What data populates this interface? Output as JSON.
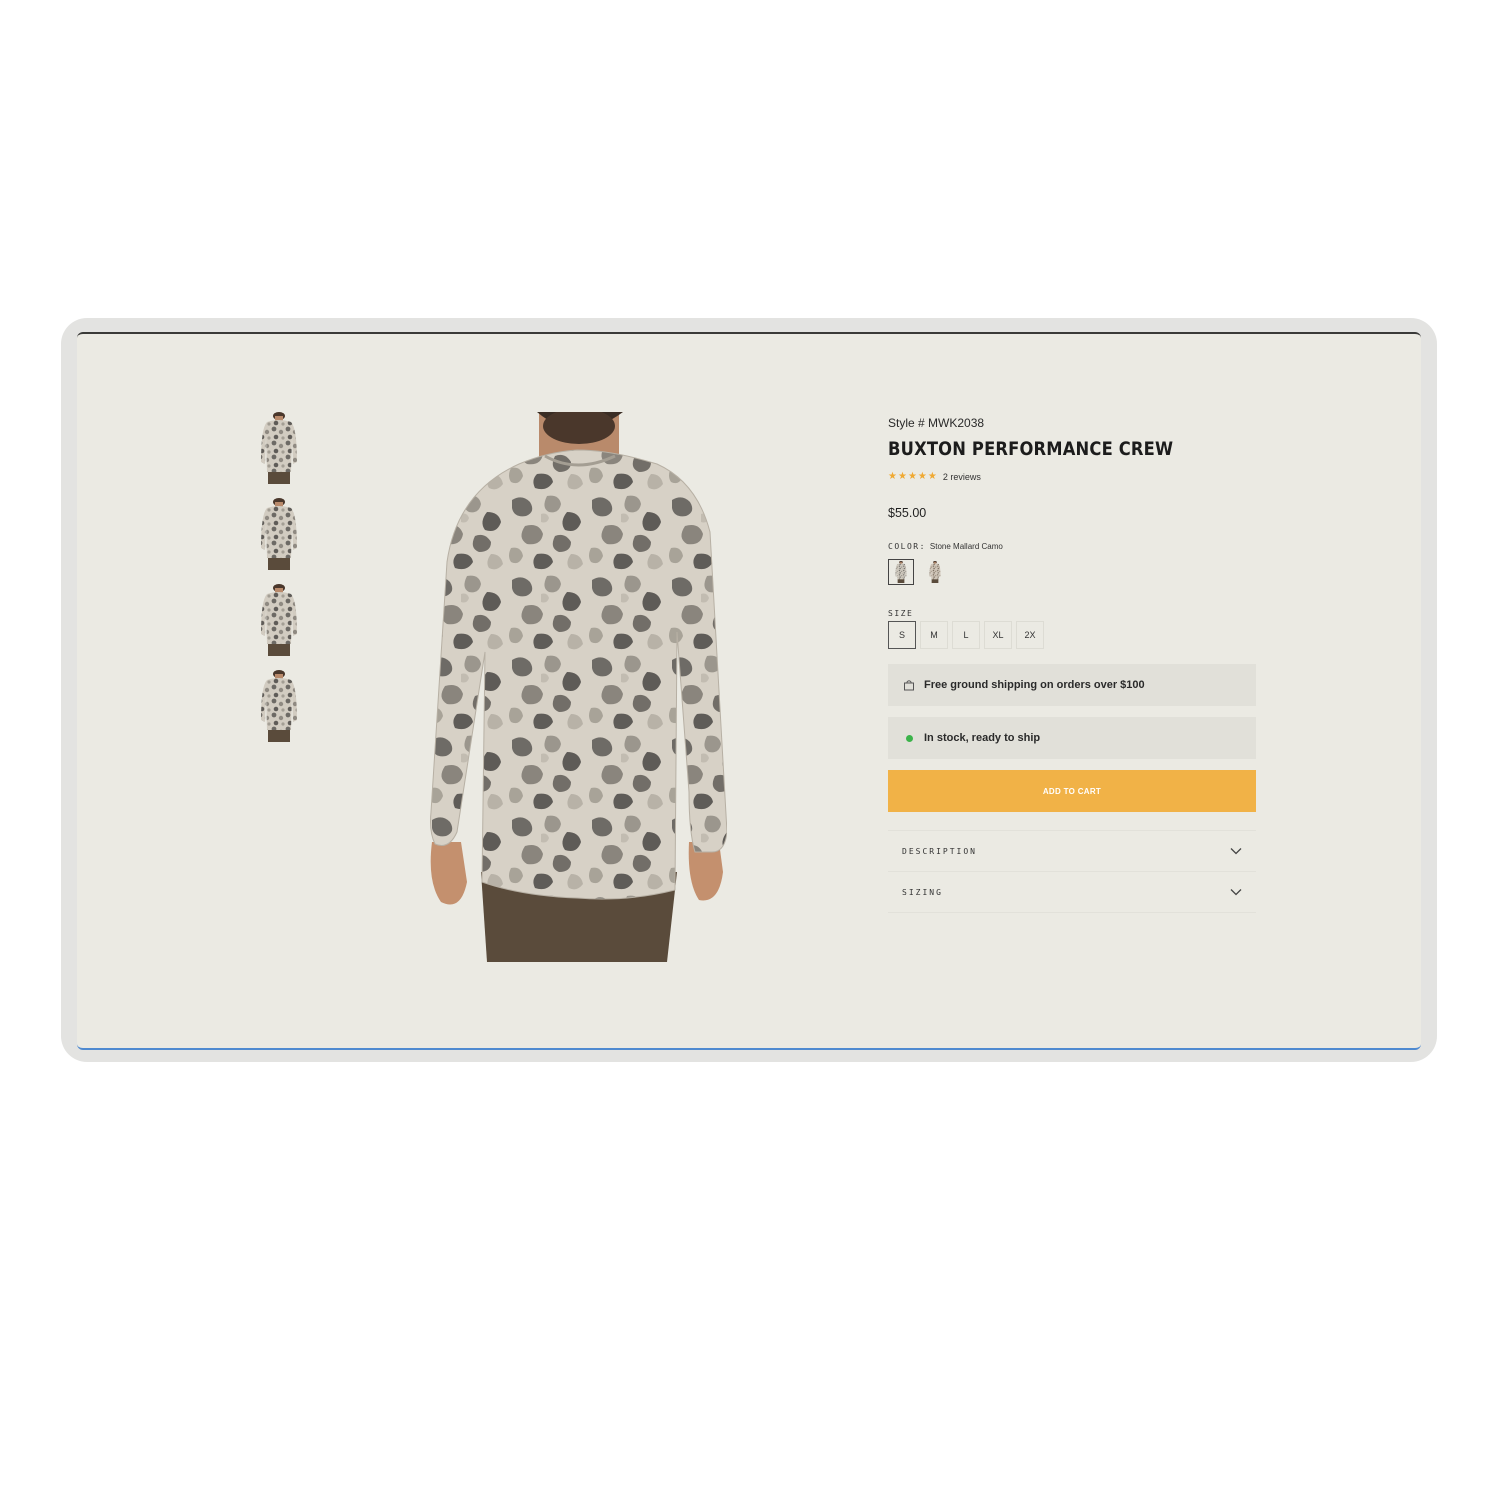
{
  "product": {
    "style_number": "Style # MWK2038",
    "title": "BUXTON PERFORMANCE CREW",
    "rating_stars": 5,
    "reviews_text": "2 reviews",
    "price": "$55.00"
  },
  "color": {
    "label": "COLOR:",
    "selected": "Stone Mallard Camo",
    "swatches": [
      "Stone Mallard Camo",
      "alternate colorway"
    ]
  },
  "size": {
    "label": "SIZE",
    "options": [
      "S",
      "M",
      "L",
      "XL",
      "2X"
    ],
    "selected": "S"
  },
  "notices": {
    "shipping": "Free ground shipping on orders over $100",
    "stock": "In stock, ready to ship"
  },
  "cart": {
    "button_label": "ADD TO CART"
  },
  "accordion": {
    "description": "DESCRIPTION",
    "sizing": "SIZING"
  },
  "colors": {
    "accent": "#f1b247",
    "page_bg": "#ebeae3",
    "notice_bg": "#e1e0d9",
    "stock_dot": "#3bb34a",
    "star": "#efa933"
  },
  "gallery": {
    "thumbnail_count": 4
  }
}
